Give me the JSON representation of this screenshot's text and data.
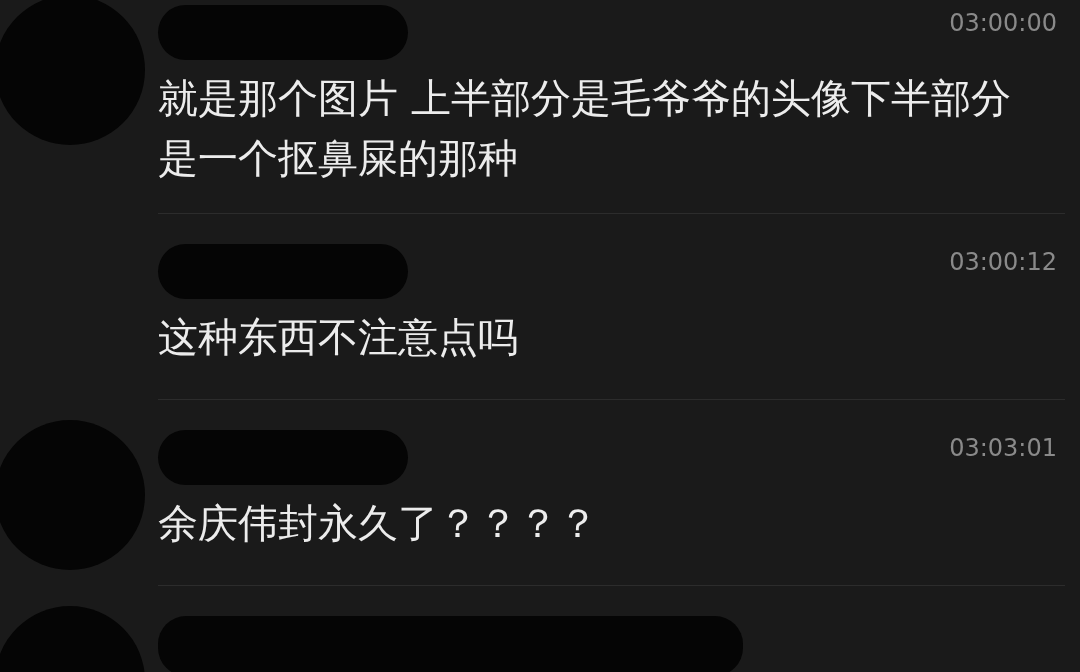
{
  "messages": [
    {
      "avatar": true,
      "time": "03:00:00",
      "text": "就是那个图片 上半部分是毛爷爷的头像下半部分是一个抠鼻屎的那种"
    },
    {
      "avatar": false,
      "time": "03:00:12",
      "text": "这种东西不注意点吗"
    },
    {
      "avatar": true,
      "time": "03:03:01",
      "text": "余庆伟封永久了？？？？"
    },
    {
      "avatar": true
    }
  ]
}
